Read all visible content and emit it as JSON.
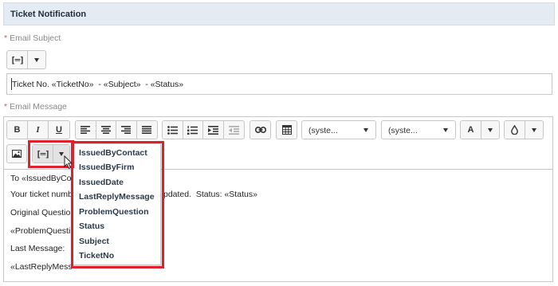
{
  "section": {
    "title": "Ticket Notification"
  },
  "subject": {
    "label": "Email Subject",
    "required_mark": "*",
    "value": "Ticket No. «TicketNo»  - «Subject»  - «Status»"
  },
  "message": {
    "label": "Email Message",
    "required_mark": "*"
  },
  "toolbar": {
    "bold": "B",
    "italic": "I",
    "underline": "U",
    "font_family_select": "(syste...",
    "font_size_select": "(syste...",
    "font_color": "A"
  },
  "editor": {
    "lines": [
      "To «IssuedByCo",
      "Your ticket numb",
      "pdated.  Status: «Status»",
      "Original Questio",
      "«ProblemQuesti",
      "Last Message:",
      "«LastReplyMess"
    ]
  },
  "merge_fields": {
    "items": [
      "IssuedByContact",
      "IssuedByFirm",
      "IssuedDate",
      "LastReplyMessage",
      "ProblemQuestion",
      "Status",
      "Subject",
      "TicketNo"
    ]
  },
  "colors": {
    "highlight": "#e0202c",
    "header_bg": "#e4ebf3",
    "required": "#d9534f"
  },
  "icons": [
    "insert-field-icon",
    "chevron-down-icon",
    "align-left-icon",
    "align-center-icon",
    "align-right-icon",
    "align-justify-icon",
    "bullet-list-icon",
    "numbered-list-icon",
    "indent-icon",
    "outdent-icon",
    "link-icon",
    "table-icon",
    "fill-color-icon",
    "image-icon",
    "mouse-pointer-icon"
  ]
}
